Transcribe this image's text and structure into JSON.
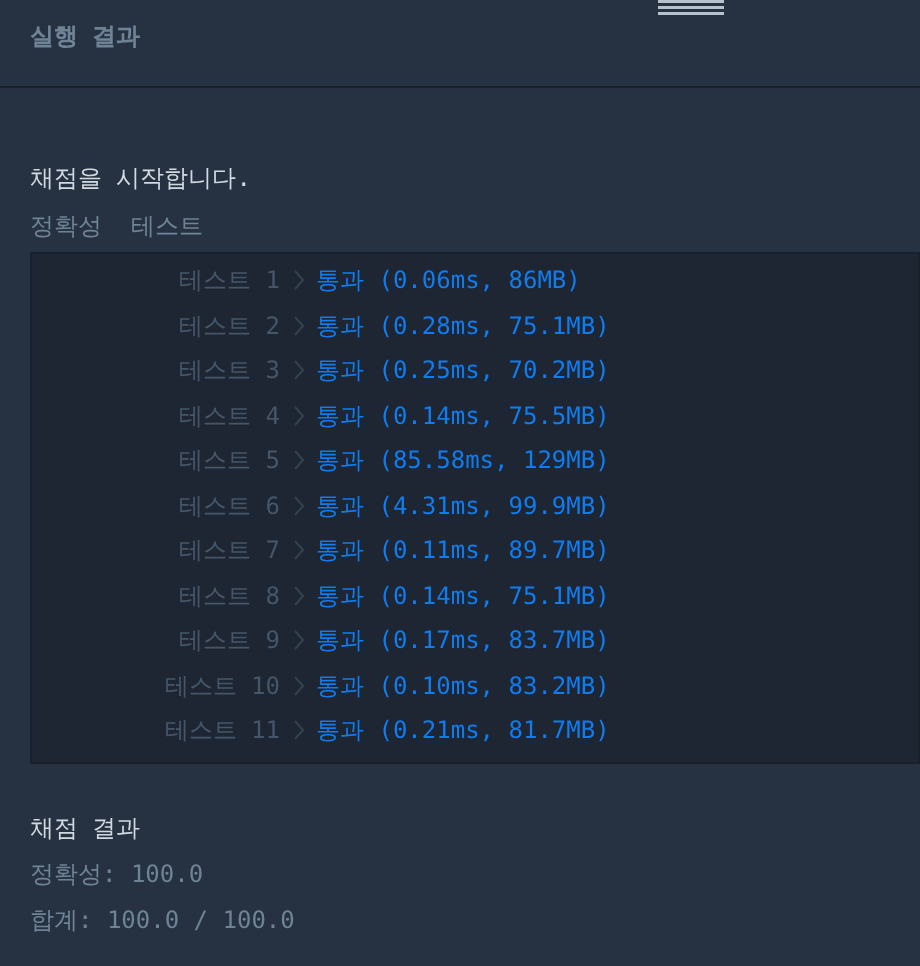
{
  "panel": {
    "title": "실행 결과"
  },
  "log": {
    "start_message": "채점을 시작합니다.",
    "section_heading": "정확성  테스트",
    "tests": [
      {
        "label": "테스트 1",
        "result": "통과 (0.06ms, 86MB)"
      },
      {
        "label": "테스트 2",
        "result": "통과 (0.28ms, 75.1MB)"
      },
      {
        "label": "테스트 3",
        "result": "통과 (0.25ms, 70.2MB)"
      },
      {
        "label": "테스트 4",
        "result": "통과 (0.14ms, 75.5MB)"
      },
      {
        "label": "테스트 5",
        "result": "통과 (85.58ms, 129MB)"
      },
      {
        "label": "테스트 6",
        "result": "통과 (4.31ms, 99.9MB)"
      },
      {
        "label": "테스트 7",
        "result": "통과 (0.11ms, 89.7MB)"
      },
      {
        "label": "테스트 8",
        "result": "통과 (0.14ms, 75.1MB)"
      },
      {
        "label": "테스트 9",
        "result": "통과 (0.17ms, 83.7MB)"
      },
      {
        "label": "테스트 10",
        "result": "통과 (0.10ms, 83.2MB)"
      },
      {
        "label": "테스트 11",
        "result": "통과 (0.21ms, 81.7MB)"
      }
    ],
    "summary_heading": "채점 결과",
    "accuracy": "정확성: 100.0",
    "total": "합계: 100.0 / 100.0"
  }
}
